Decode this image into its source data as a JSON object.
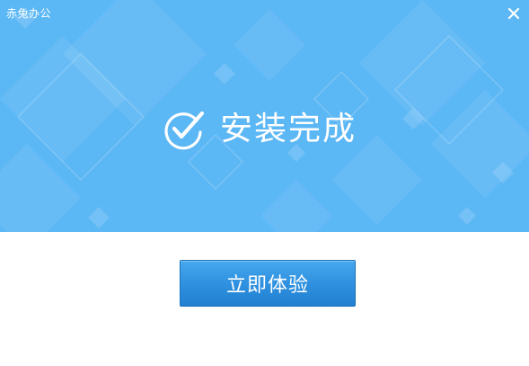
{
  "window": {
    "title": "赤兔办公"
  },
  "status": {
    "icon": "check-circle-icon",
    "text": "安装完成"
  },
  "actions": {
    "primary_label": "立即体验"
  },
  "controls": {
    "close_icon": "close-icon",
    "close_glyph": "✕"
  },
  "colors": {
    "banner": "#5cb7f5",
    "button": "#2d8fde",
    "text_on_accent": "#ffffff"
  }
}
